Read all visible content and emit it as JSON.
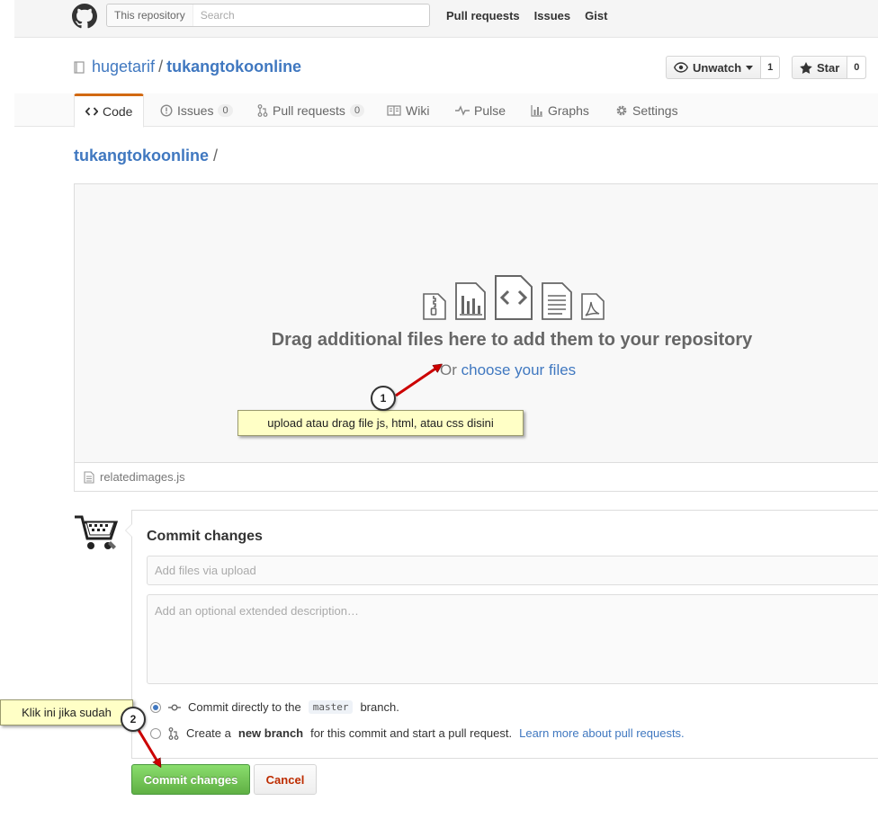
{
  "header": {
    "scope_label": "This repository",
    "search_placeholder": "Search",
    "nav": [
      "Pull requests",
      "Issues",
      "Gist"
    ]
  },
  "repo": {
    "owner": "hugetarif",
    "separator": "/",
    "name": "tukangtokoonline",
    "unwatch_label": "Unwatch",
    "unwatch_count": "1",
    "star_label": "Star",
    "star_count": "0"
  },
  "tabs": {
    "code": "Code",
    "issues": "Issues",
    "issues_count": "0",
    "pulls": "Pull requests",
    "pulls_count": "0",
    "wiki": "Wiki",
    "pulse": "Pulse",
    "graphs": "Graphs",
    "settings": "Settings"
  },
  "breadcrumb": {
    "repo": "tukangtokoonline",
    "sep": "/"
  },
  "dropzone": {
    "heading": "Drag additional files here to add them to your repository",
    "sub_prefix": "Or ",
    "sub_link": "choose your files",
    "file_icons": [
      "zip-file-icon",
      "chart-file-icon",
      "code-file-icon",
      "text-file-icon",
      "pdf-file-icon"
    ]
  },
  "uploaded_file": "relatedimages.js",
  "commit": {
    "title": "Commit changes",
    "summary_placeholder": "Add files via upload",
    "description_placeholder": "Add an optional extended description…",
    "option1_prefix": "Commit directly to the",
    "option1_branch": "master",
    "option1_suffix": "branch.",
    "option2_prefix": "Create a",
    "option2_bold": "new branch",
    "option2_suffix": "for this commit and start a pull request.",
    "option2_link": "Learn more about pull requests.",
    "commit_button": "Commit changes",
    "cancel_button": "Cancel"
  },
  "annotations": {
    "step1_number": "1",
    "step1_text": "upload atau drag file js, html, atau css disini",
    "step2_number": "2",
    "step2_text": "Klik ini jika sudah",
    "arrow_color": "#cc0000"
  }
}
